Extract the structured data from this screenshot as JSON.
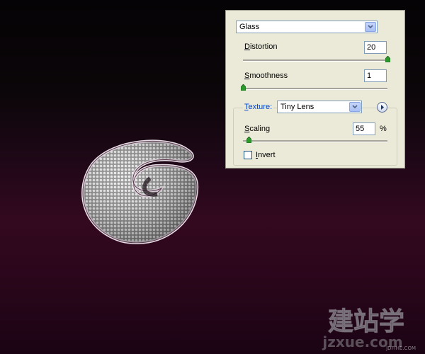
{
  "filter": {
    "name": "Glass",
    "distortion": {
      "label": "Distortion",
      "mnemonic": "D",
      "rest": "istortion",
      "value": "20",
      "fraction": 1.0
    },
    "smoothness": {
      "label": "Smoothness",
      "mnemonic": "S",
      "rest": "moothness",
      "value": "1",
      "fraction": 0.0
    },
    "texture": {
      "label": "Texture:",
      "mnemonic": "T",
      "rest": "exture:",
      "value": "Tiny Lens"
    },
    "scaling": {
      "label": "Scaling",
      "mnemonic": "S",
      "rest": "caling",
      "value": "55",
      "unit": "%",
      "fraction": 0.04
    },
    "invert": {
      "label": "Invert",
      "mnemonic": "I",
      "rest": "nvert",
      "checked": false
    }
  },
  "icons": {
    "dropdown": "chevron-down-icon",
    "texture_menu": "play-arrow-icon",
    "slider": "slider-thumb-icon"
  },
  "colors": {
    "panel_bg": "#ebe9d8",
    "accent_link": "#0046d5",
    "slider_thumb": "#2b9a2b"
  },
  "watermark": {
    "main": "建站学",
    "sub": "jzxue.com",
    "small": "JDFIHE.COM"
  }
}
